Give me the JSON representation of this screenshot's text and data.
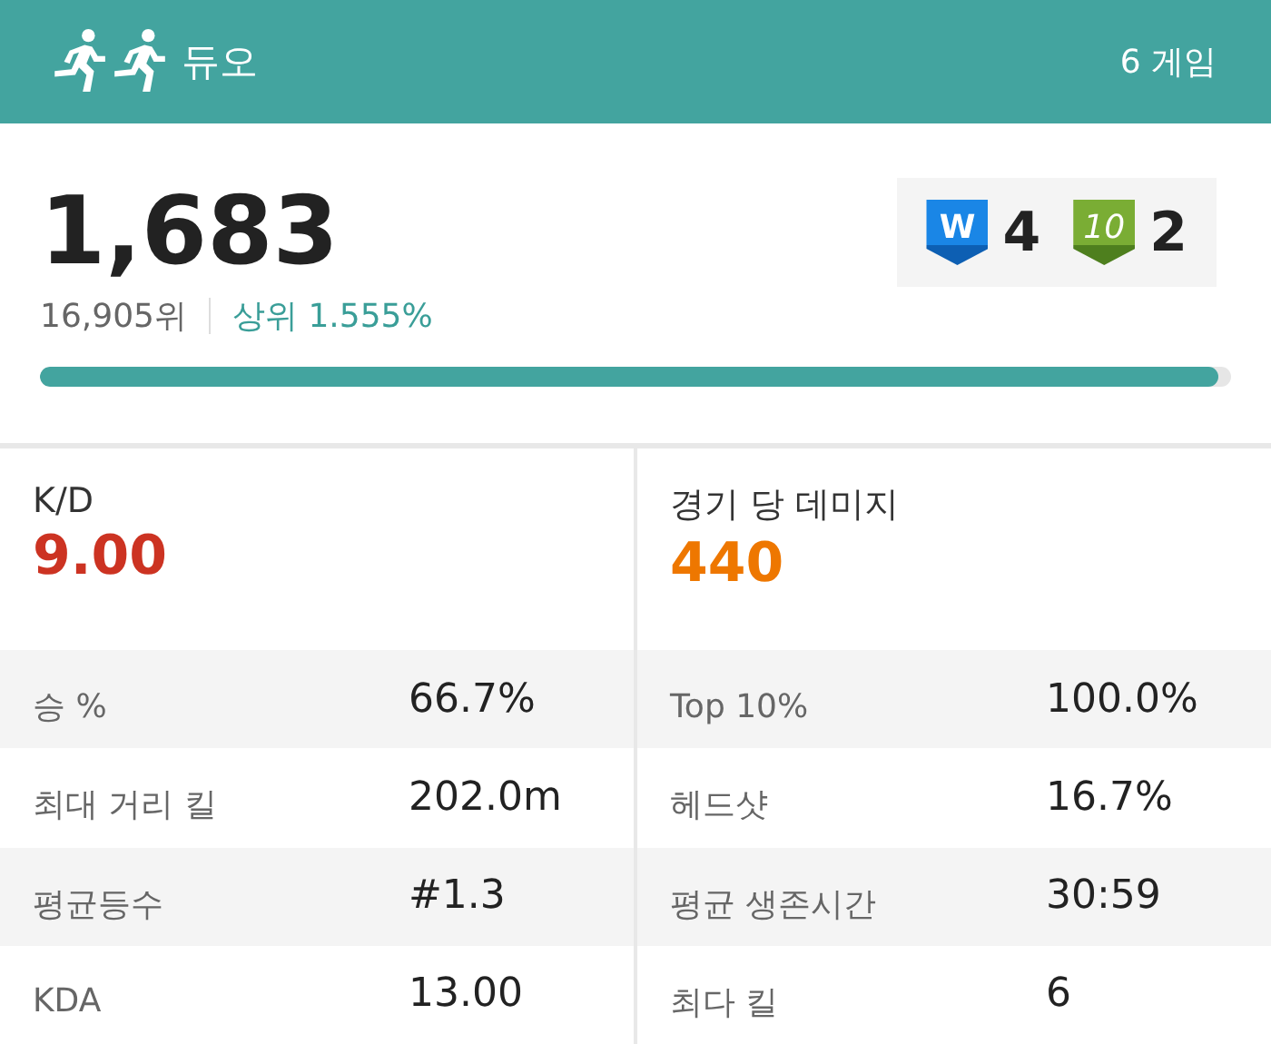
{
  "header": {
    "mode": "듀오",
    "games": "6 게임"
  },
  "summary": {
    "rating": "1,683",
    "rank": "16,905위",
    "top_percent": "상위 1.555%",
    "level": 0.99,
    "badges": [
      {
        "kind": "win",
        "icon_text": "W",
        "count": "4"
      },
      {
        "kind": "top10",
        "icon_text": "10",
        "count": "2"
      }
    ]
  },
  "columns": [
    {
      "headline": {
        "label": "K/D",
        "value": "9.00",
        "color": "#cc3322"
      },
      "stats": [
        {
          "label": "승 %",
          "value": "66.7%"
        },
        {
          "label": "최대 거리 킬",
          "value": "202.0m"
        },
        {
          "label": "평균등수",
          "value": "#1.3"
        },
        {
          "label": "KDA",
          "value": "13.00"
        }
      ]
    },
    {
      "headline": {
        "label": "경기 당 데미지",
        "value": "440",
        "color": "#ee7700"
      },
      "stats": [
        {
          "label": "Top 10%",
          "value": "100.0%"
        },
        {
          "label": "헤드샷",
          "value": "16.7%"
        },
        {
          "label": "평균 생존시간",
          "value": "30:59"
        },
        {
          "label": "최다 킬",
          "value": "6"
        }
      ]
    }
  ]
}
